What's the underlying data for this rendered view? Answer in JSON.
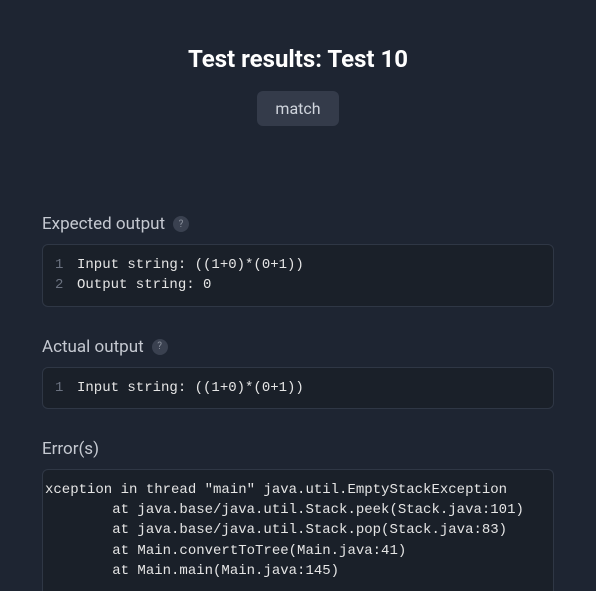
{
  "header": {
    "title": "Test results: Test 10",
    "badge_label": "match"
  },
  "expected": {
    "title": "Expected output",
    "help": "?",
    "lines": [
      {
        "num": "1",
        "text": "Input string: ((1+0)*(0+1))"
      },
      {
        "num": "2",
        "text": "Output string: 0"
      }
    ]
  },
  "actual": {
    "title": "Actual output",
    "help": "?",
    "lines": [
      {
        "num": "1",
        "text": "Input string: ((1+0)*(0+1))"
      }
    ]
  },
  "errors": {
    "title": "Error(s)",
    "lines": [
      "xception in thread \"main\" java.util.EmptyStackException",
      "        at java.base/java.util.Stack.peek(Stack.java:101)",
      "        at java.base/java.util.Stack.pop(Stack.java:83)",
      "        at Main.convertToTree(Main.java:41)",
      "        at Main.main(Main.java:145)"
    ]
  }
}
